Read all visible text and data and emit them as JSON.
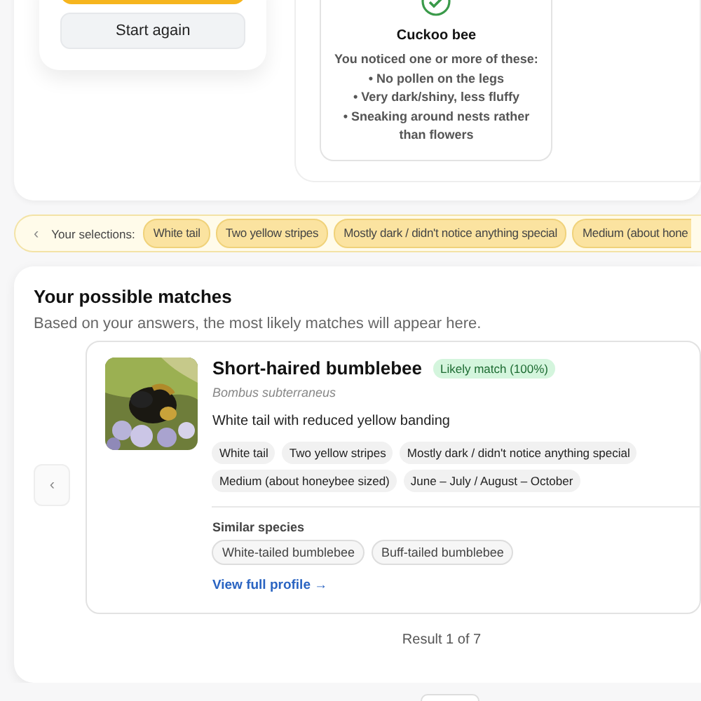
{
  "start_card": {
    "secondary_button": "Start again"
  },
  "cuckoo_card": {
    "title": "Cuckoo bee",
    "intro": "You noticed one or more of these:",
    "points": [
      "• No pollen on the legs",
      "• Very dark/shiny, less fluffy",
      "• Sneaking around nests rather than flowers"
    ]
  },
  "selections": {
    "scroll_left": "‹",
    "label": "Your selections:",
    "chips": [
      "White tail",
      "Two yellow stripes",
      "Mostly dark / didn't notice anything special",
      "Medium (about hone"
    ]
  },
  "matches": {
    "title": "Your possible matches",
    "subtitle": "Based on your answers, the most likely matches will appear here.",
    "prev": "‹",
    "result": {
      "name": "Short-haired bumblebee",
      "badge": "Likely match (100%)",
      "latin": "Bombus subterraneus",
      "description": "White tail with reduced yellow banding",
      "tags": [
        "White tail",
        "Two yellow stripes",
        "Mostly dark / didn't notice anything special",
        "Medium (about honeybee sized)",
        "June – July / August – October"
      ],
      "similar_label": "Similar species",
      "similar": [
        "White-tailed bumblebee",
        "Buff-tailed bumblebee"
      ],
      "link": "View full profile →"
    },
    "counter": "Result 1 of 7"
  }
}
